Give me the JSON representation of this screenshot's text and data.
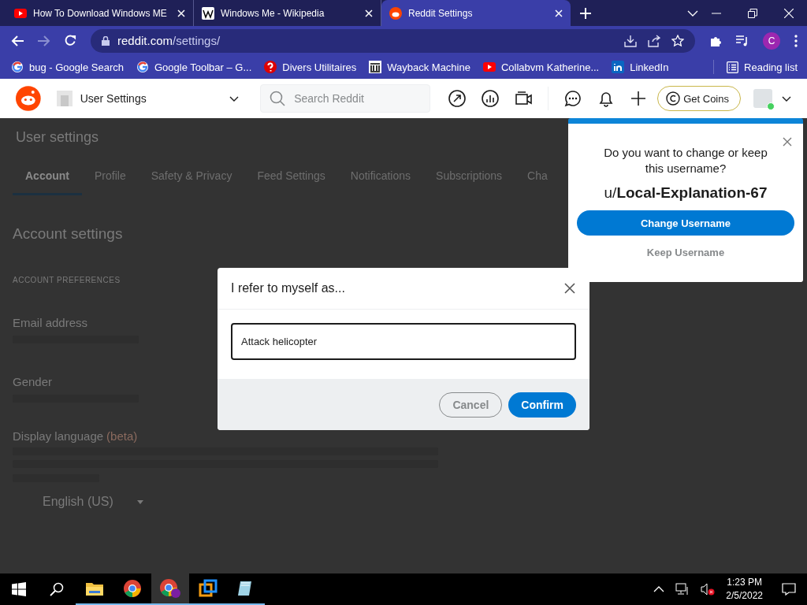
{
  "browser": {
    "tabs": [
      {
        "title": "How To Download Windows ME",
        "kind": "youtube",
        "selected": false
      },
      {
        "title": "Windows Me - Wikipedia",
        "kind": "wikipedia",
        "selected": false
      },
      {
        "title": "Reddit Settings",
        "kind": "reddit",
        "selected": true
      }
    ],
    "address": {
      "host": "reddit.com",
      "path": "/settings/"
    },
    "profile_initial": "C",
    "bookmarks": [
      {
        "label": "bug - Google Search",
        "kind": "google"
      },
      {
        "label": "Google Toolbar – G...",
        "kind": "google"
      },
      {
        "label": "Divers Utilitaires",
        "kind": "question"
      },
      {
        "label": "Wayback Machine",
        "kind": "archive"
      },
      {
        "label": "Collabvm Katherine...",
        "kind": "youtube"
      },
      {
        "label": "LinkedIn",
        "kind": "linkedin"
      }
    ],
    "reading_list": "Reading list"
  },
  "header": {
    "community": "User Settings",
    "search": {
      "placeholder": "Search Reddit"
    },
    "coins": "Get Coins",
    "online": true
  },
  "page": {
    "title": "User settings",
    "tabs": [
      {
        "label": "Account",
        "selected": true
      },
      {
        "label": "Profile",
        "selected": false
      },
      {
        "label": "Safety & Privacy",
        "selected": false
      },
      {
        "label": "Feed Settings",
        "selected": false
      },
      {
        "label": "Notifications",
        "selected": false
      },
      {
        "label": "Subscriptions",
        "selected": false
      },
      {
        "label": "Cha",
        "selected": false
      }
    ],
    "section": "Account settings",
    "group": "ACCOUNT PREFERENCES",
    "fields": [
      {
        "label": "Email address"
      },
      {
        "label": "Gender"
      }
    ],
    "language": {
      "label": "Display language",
      "badge": "(beta)",
      "value": "English (US)"
    }
  },
  "modal": {
    "title": "I refer to myself as...",
    "value": "Attack helicopter",
    "buttons": [
      {
        "label": "Cancel",
        "kind": "secondary"
      },
      {
        "label": "Confirm",
        "kind": "primary"
      }
    ]
  },
  "popup": {
    "question": "Do you want to change or keep this username?",
    "prefix": "u/",
    "username": "Local-Explanation-67",
    "buttons": [
      {
        "label": "Change Username",
        "kind": "primary"
      },
      {
        "label": "Keep Username",
        "kind": "text"
      }
    ]
  },
  "taskbar": {
    "apps": [
      {
        "kind": "explorer",
        "active": false
      },
      {
        "kind": "chrome",
        "active": false
      },
      {
        "kind": "chrome-profile",
        "active": true
      },
      {
        "kind": "vm",
        "active": false
      },
      {
        "kind": "notepad",
        "active": false
      }
    ],
    "time": "1:23 PM",
    "date": "2/5/2022"
  }
}
